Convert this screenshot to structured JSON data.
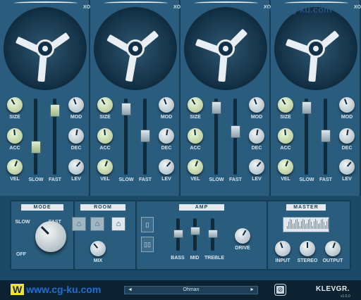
{
  "watermark": "www.cg-ku.com",
  "channels": [
    {
      "xo": "XO",
      "labels": {
        "size": "SIZE",
        "acc": "ACC",
        "vel": "VEL",
        "mod": "MOD",
        "dec": "DEC",
        "lev": "LEV",
        "slow": "SLOW",
        "fast": "FAST"
      }
    },
    {
      "xo": "XO",
      "labels": {
        "size": "SIZE",
        "acc": "ACC",
        "vel": "VEL",
        "mod": "MOD",
        "dec": "DEC",
        "lev": "LEV",
        "slow": "SLOW",
        "fast": "FAST"
      }
    },
    {
      "xo": "XO",
      "labels": {
        "size": "SIZE",
        "acc": "ACC",
        "vel": "VEL",
        "mod": "MOD",
        "dec": "DEC",
        "lev": "LEV",
        "slow": "SLOW",
        "fast": "FAST"
      }
    },
    {
      "xo": "XO",
      "labels": {
        "size": "SIZE",
        "acc": "ACC",
        "vel": "VEL",
        "mod": "MOD",
        "dec": "DEC",
        "lev": "LEV",
        "slow": "SLOW",
        "fast": "FAST"
      }
    }
  ],
  "mode": {
    "title": "MODE",
    "slow": "SLOW",
    "fast": "FAST",
    "off": "OFF"
  },
  "room": {
    "title": "ROOM",
    "mix": "MIX"
  },
  "amp": {
    "title": "AMP",
    "bass": "BASS",
    "mid": "MID",
    "treble": "TREBLE",
    "drive": "DRIVE"
  },
  "master": {
    "title": "MASTER",
    "input": "INPUT",
    "stereo": "STEREO",
    "output": "OUTPUT"
  },
  "footer": {
    "preset": "Ohman",
    "prev": "◄",
    "next": "►",
    "brand": "KLEVGR.",
    "version": "v1.0.0"
  },
  "colors": {
    "accent": "#1b4a68",
    "panel": "#2a5c7d",
    "knob_green": "#a8c08c"
  }
}
